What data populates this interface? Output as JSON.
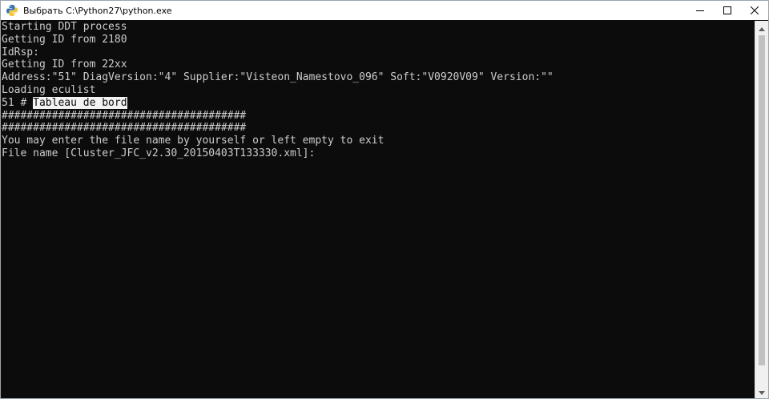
{
  "window": {
    "title": "Выбрать C:\\Python27\\python.exe",
    "icon": "python-icon"
  },
  "controls": {
    "minimize": "minimize-icon",
    "maximize": "maximize-icon",
    "close": "close-icon"
  },
  "console": {
    "lines": [
      "Starting DDT process",
      "Getting ID from 2180",
      "IdRsp:",
      "Getting ID from 22xx",
      "Address:\"51\" DiagVersion:\"4\" Supplier:\"Visteon_Namestovo_096\" Soft:\"V0920V09\" Version:\"\"",
      "Loading eculist",
      "#######################################",
      "#######################################",
      "You may enter the file name by yourself or left empty to exit",
      "File name [Cluster_JFC_v2.30_20150403T133330.xml]:"
    ],
    "selection_prefix": "51 # ",
    "selection_text": "Tableau de bord"
  },
  "colors": {
    "console_bg": "#0c0c0c",
    "console_fg": "#cccccc",
    "selection_bg": "#f2f2f2"
  }
}
